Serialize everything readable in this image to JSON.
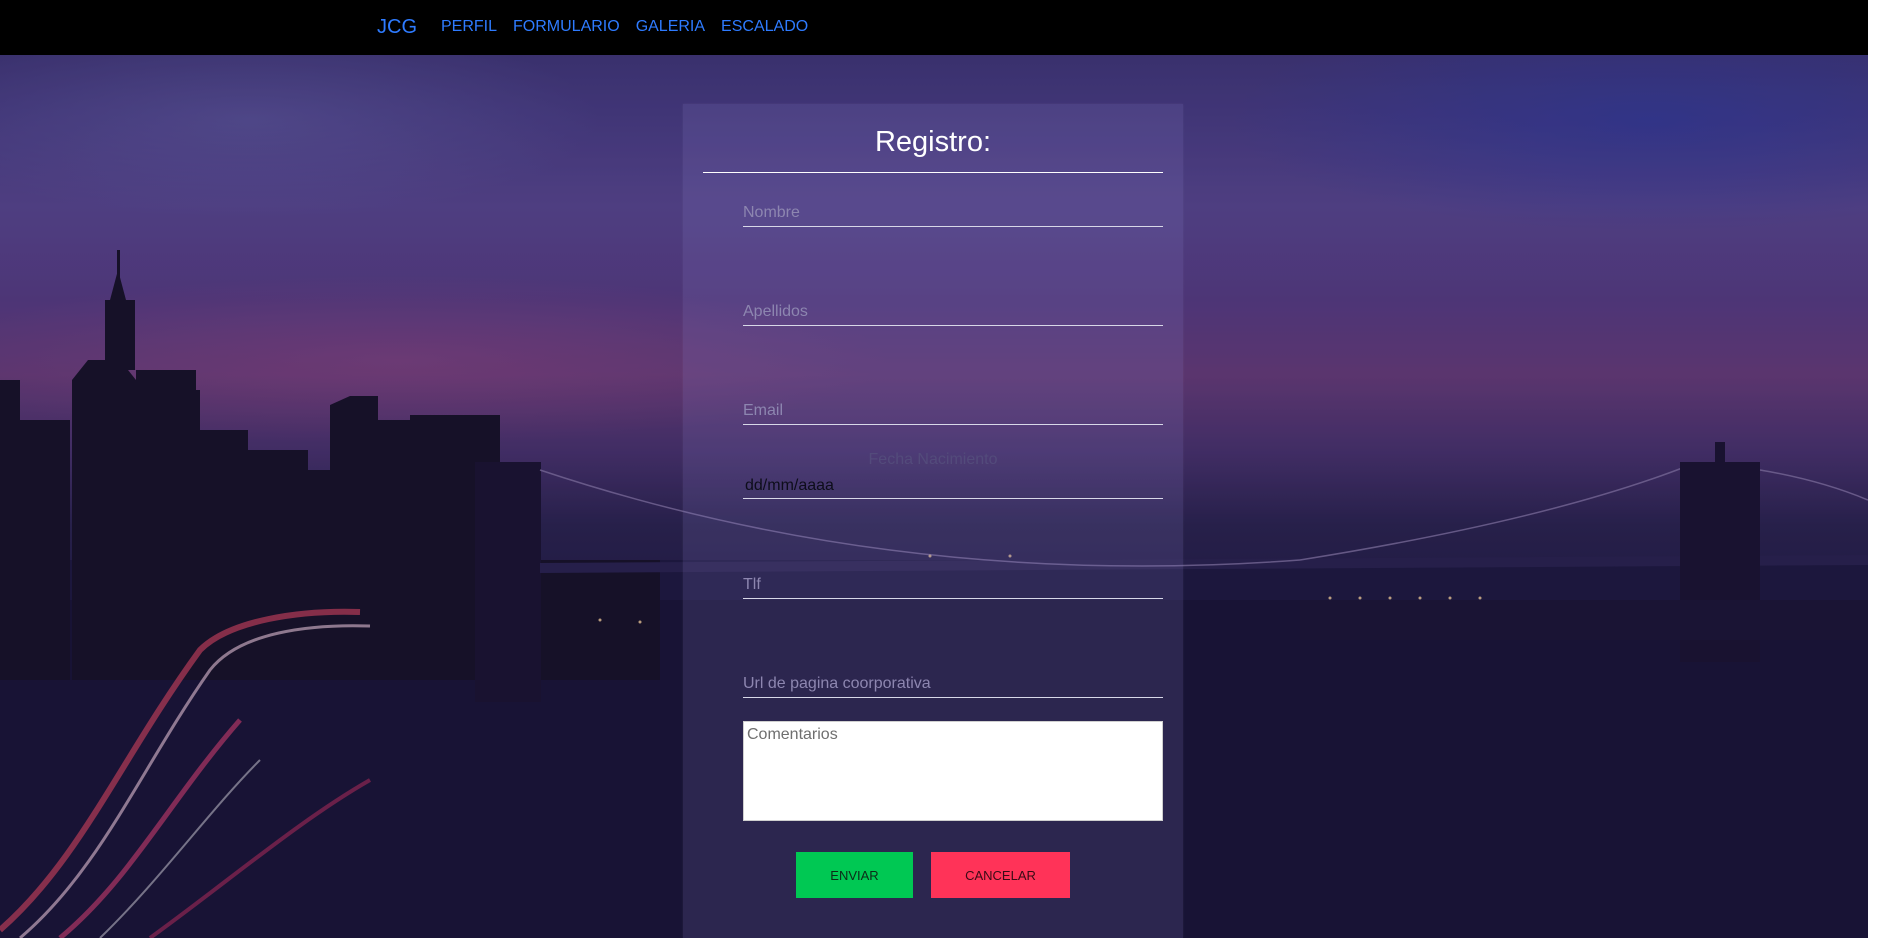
{
  "navbar": {
    "brand": "JCG",
    "links": [
      {
        "label": "PERFIL"
      },
      {
        "label": "FORMULARIO"
      },
      {
        "label": "GALERIA"
      },
      {
        "label": "ESCALADO"
      }
    ],
    "link_color": "#2e7bff",
    "background": "#000000"
  },
  "form": {
    "title": "Registro:",
    "fields": {
      "nombre_placeholder": "Nombre",
      "apellidos_placeholder": "Apellidos",
      "email_placeholder": "Email",
      "fecha_label": "Fecha Nacimiento",
      "fecha_value": "dd/mm/aaaa",
      "tlf_placeholder": "Tlf",
      "url_placeholder": "Url de pagina coorporativa",
      "comentarios_placeholder": "Comentarios"
    },
    "buttons": {
      "send": "ENVIAR",
      "cancel": "CANCELAR"
    },
    "colors": {
      "send": "#00c853",
      "cancel": "#ff3358"
    }
  }
}
